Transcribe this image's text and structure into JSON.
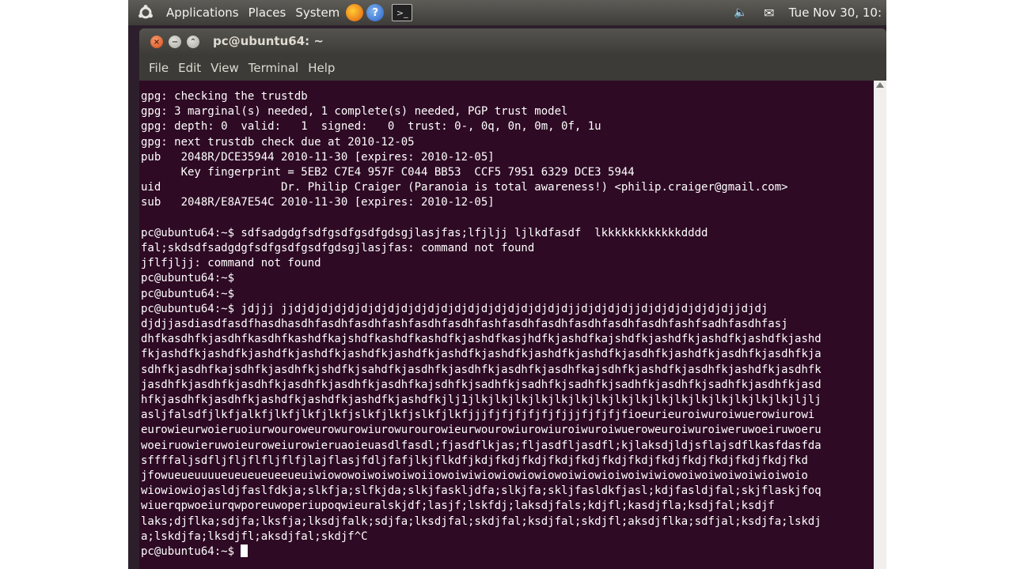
{
  "panel": {
    "applications": "Applications",
    "places": "Places",
    "system": "System",
    "datetime": "Tue Nov 30, 10:"
  },
  "window": {
    "title": "pc@ubuntu64: ~",
    "menu": [
      "File",
      "Edit",
      "View",
      "Terminal",
      "Help"
    ]
  },
  "terminal": {
    "lines": [
      "gpg: checking the trustdb",
      "gpg: 3 marginal(s) needed, 1 complete(s) needed, PGP trust model",
      "gpg: depth: 0  valid:   1  signed:   0  trust: 0-, 0q, 0n, 0m, 0f, 1u",
      "gpg: next trustdb check due at 2010-12-05",
      "pub   2048R/DCE35944 2010-11-30 [expires: 2010-12-05]",
      "      Key fingerprint = 5EB2 C7E4 957F C044 BB53  CCF5 7951 6329 DCE3 5944",
      "uid                  Dr. Philip Craiger (Paranoia is total awareness!) <philip.craiger@gmail.com>",
      "sub   2048R/E8A7E54C 2010-11-30 [expires: 2010-12-05]",
      "",
      "pc@ubuntu64:~$ sdfsadgdgfsdfgsdfgsdfgdsgjlasjfas;lfjljj ljlkdfasdf  lkkkkkkkkkkkkdddd",
      "fal;skdsdfsadgdgfsdfgsdfgsdfgdsgjlasjfas: command not found",
      "jflfjljj: command not found",
      "pc@ubuntu64:~$",
      "pc@ubuntu64:~$",
      "pc@ubuntu64:~$ jdjjj jjdjdjdjdjdjdjdjdjdjdjdjdjdjdjdjdjdjdjdjdjdjjdjdjdjdjjdjdjdjdjdjdjdjjdjdj",
      "djdjjasdiasdfasdfhasdhasdhfasdhfasdhfashfasdhfasdhfashfasdhfasdhfasdhfasdhfasdhfashfsadhfasdhfasj",
      "dhfkasdhfkjasdhfkasdhfkashdfkajshdfkashdfkashdfkjashdfkasjhdfkjashdfkajshdfkjashdfkjashdfkjashdfkjashd",
      "fkjashdfkjashdfkjashdfkjashdfkjashdfkjashdfkjashdfkjashdfkjashdfkjashdfkjasdhfkjashdfkjasdhfkjasdhfkja",
      "sdhfkjasdhfkajsdhfkjasdhfkjshdfkjsahdfkjasdhfkjasdhfkjasdhfkjasdhfkajsdhfkjashdfkjasdhfkjashdfkjasdhfk",
      "jasdhfkjasdhfkjasdhfkjasdhfkjasdhfkjasdhfkajsdhfkjsadhfkjsadhfkjsadhfkjsadhfkjasdhfkjsadhfkjasdhfkjasd",
      "hfkjasdhfkjasdhfkjashdfkjashdfkjashdfkjashdfkjlj1jlkjlkjlkjlkjlkjlkjlkjlkjlkjlkjlkjlkjlkjlkjlkjlkjljlj",
      "asljfalsdfjlkfjalkfjlkfjlkfjlkfjslkfjlkfjslkfjlkfjjjfjfjfjfjfjfjjjfjfjfjfioeurieuroiwuroiwuerowiurowi",
      "eurowieurwoieruoiurwouroweurowurowiurowurourowieurwourowiurowiuroiwuroiwueroweuroiwuroiweruwoeiruwoeru",
      "woeiruowieruwoieuroweiurowieruaoieuasdlfasdl;fjasdflkjas;fljasdfljasdfl;kjlaksdjldjsflajsdflkasfdasfda",
      "sffffaljsdfljfljflfljflfjlajflasjfdljfafjlkjflkdfjkdjfkdjfkdjfkdjfkdjfkdjfkdjfkdjfkdjfkdjfkdjfkdjfkd",
      "jfowueueuuuueueueueueeueuiwiowowoiwoiwoiwoiiowoiwiwiowiowiowiowoiwiowioiwoiwiwiowoiwoiwoiwoiwioiwoio",
      "wiowiowiojasldjfaslfdkja;slkfja;slfkjda;slkjfaskljdfa;slkjfa;skljfasldkfjasl;kdjfasldjfal;skjflaskjfoq",
      "wiuerqpwoeiurqwporeuwoperiupoqwieuralskjdf;lasjf;lskfdj;laksdjfals;kdjfl;kasdjfla;ksdjfal;ksdjf",
      "laks;djflka;sdjfa;lksfja;lksdjfalk;sdjfa;lksdjfal;skdjfal;ksdjfal;skdjfl;aksdjflka;sdfjal;ksdjfa;lskdj",
      "a;lskdjfa;lksdjfl;aksdjfal;skdjf^C"
    ],
    "prompt": "pc@ubuntu64:~$ "
  }
}
